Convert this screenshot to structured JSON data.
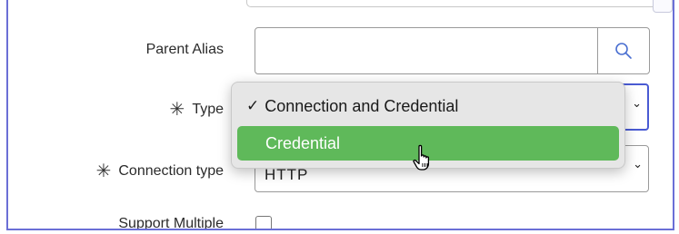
{
  "form": {
    "parent_alias": {
      "label": "Parent Alias",
      "value": ""
    },
    "type": {
      "label": "Type",
      "required_mark": "✳"
    },
    "connection_type": {
      "label": "Connection type",
      "required_mark": "✳",
      "value": "HTTP"
    },
    "support_multiple": {
      "label": "Support Multiple",
      "checked": false
    }
  },
  "dropdown": {
    "options": [
      {
        "label": "Connection and Credential",
        "selected": true,
        "check": "✓"
      },
      {
        "label": "Credential",
        "selected": false,
        "highlighted": true
      }
    ]
  },
  "icons": {
    "search": "search-icon",
    "chevron": "chevron-down-icon",
    "cursor": "hand-pointer-icon"
  },
  "colors": {
    "frame_border": "#6b6fd6",
    "focus_border": "#4a5bd3",
    "highlight": "#5fb95a",
    "search_icon": "#4a6fd1"
  }
}
